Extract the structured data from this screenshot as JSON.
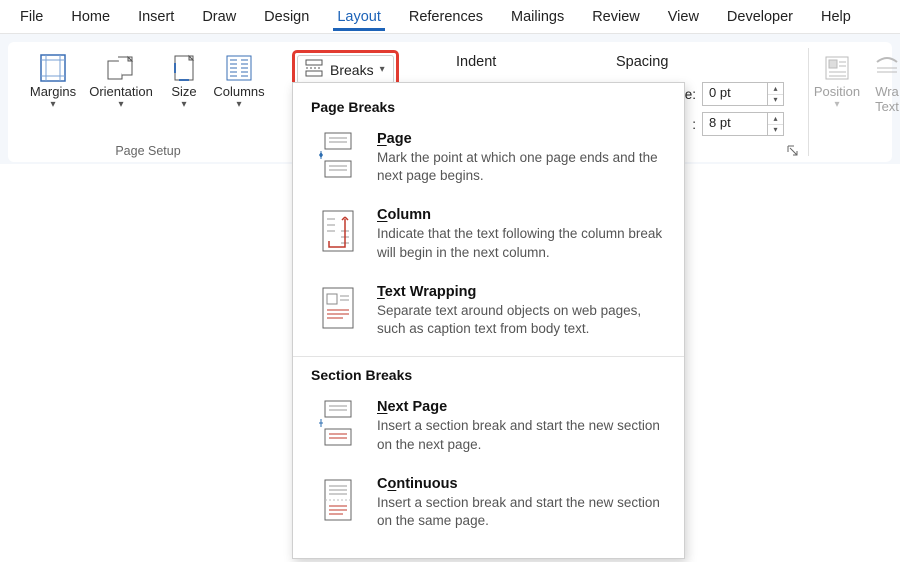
{
  "tabs": {
    "file": "File",
    "home": "Home",
    "insert": "Insert",
    "draw": "Draw",
    "design": "Design",
    "layout": "Layout",
    "references": "References",
    "mailings": "Mailings",
    "review": "Review",
    "view": "View",
    "developer": "Developer",
    "help": "Help"
  },
  "ribbon": {
    "page_setup": {
      "margins": "Margins",
      "orientation": "Orientation",
      "size": "Size",
      "columns": "Columns",
      "group_label": "Page Setup",
      "breaks": "Breaks"
    },
    "paragraph": {
      "indent_label": "Indent",
      "spacing_label": "Spacing",
      "before_suffix": "re:",
      "after_suffix": ":",
      "before_value": "0 pt",
      "after_value": "8 pt"
    },
    "arrange": {
      "position": "Position",
      "wrap_text_l1": "Wra",
      "wrap_text_l2": "Text"
    }
  },
  "dropdown": {
    "page_breaks_title": "Page Breaks",
    "section_breaks_title": "Section Breaks",
    "items": {
      "page": {
        "title_pre": "",
        "title_u": "P",
        "title_post": "age",
        "desc": "Mark the point at which one page ends and the next page begins."
      },
      "column": {
        "title_pre": "",
        "title_u": "C",
        "title_post": "olumn",
        "desc": "Indicate that the text following the column break will begin in the next column."
      },
      "text_wrapping": {
        "title_pre": "",
        "title_u": "T",
        "title_post": "ext Wrapping",
        "desc": "Separate text around objects on web pages, such as caption text from body text."
      },
      "next_page": {
        "title_pre": "",
        "title_u": "N",
        "title_post": "ext Page",
        "desc": "Insert a section break and start the new section on the next page."
      },
      "continuous": {
        "title_pre": "C",
        "title_u": "o",
        "title_post": "ntinuous",
        "desc": "Insert a section break and start the new section on the same page."
      }
    }
  }
}
